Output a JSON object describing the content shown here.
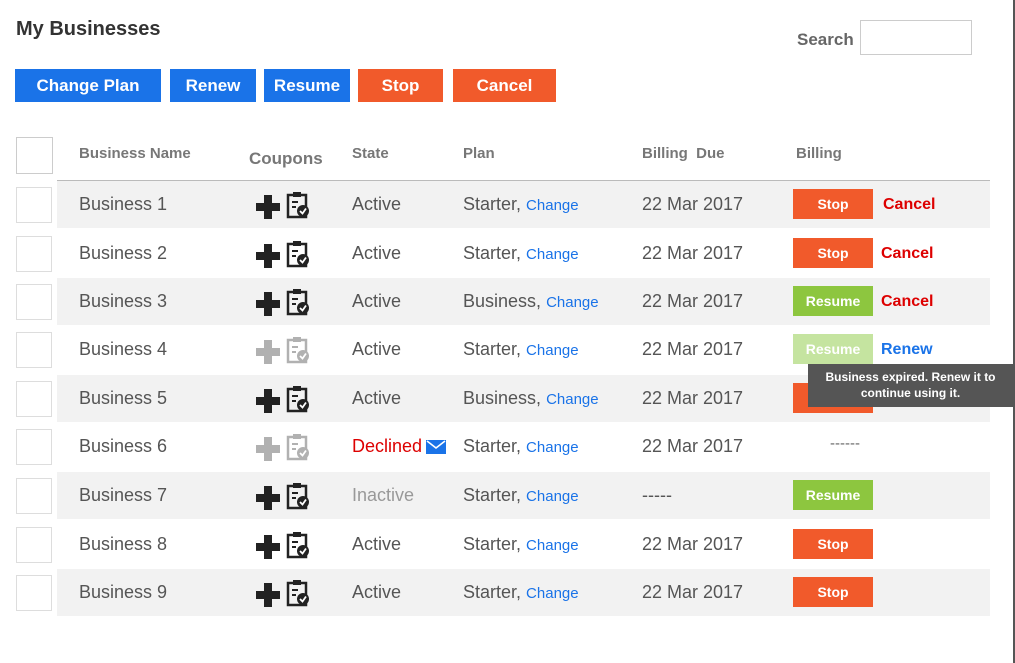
{
  "page": {
    "title": "My Businesses",
    "search_label": "Search",
    "search_value": ""
  },
  "toolbar": {
    "change_plan": "Change Plan",
    "renew": "Renew",
    "resume": "Resume",
    "stop": "Stop",
    "cancel": "Cancel"
  },
  "columns": {
    "business_name": "Business Name",
    "coupons": "Coupons",
    "state": "State",
    "plan": "Plan",
    "billing_due": "Billing  Due",
    "billing": "Billing"
  },
  "rows": [
    {
      "name": "Business 1",
      "state": "Active",
      "plan": "Starter,",
      "plan_link": "Change",
      "due": "22 Mar 2017",
      "btn": "Stop",
      "link": "Cancel"
    },
    {
      "name": "Business 2",
      "state": "Active",
      "plan": "Starter,",
      "plan_link": "Change",
      "due": "22 Mar 2017",
      "btn": "Stop",
      "link": "Cancel"
    },
    {
      "name": "Business 3",
      "state": "Active",
      "plan": "Business,",
      "plan_link": "Change",
      "due": "22 Mar 2017",
      "btn": "Resume",
      "link": "Cancel"
    },
    {
      "name": "Business 4",
      "state": "Active",
      "plan": "Starter,",
      "plan_link": "Change",
      "due": "22 Mar 2017",
      "btn": "Resume",
      "link": "Renew"
    },
    {
      "name": "Business 5",
      "state": "Active",
      "plan": "Business,",
      "plan_link": "Change",
      "due": "22 Mar 2017",
      "btn": "",
      "link": ""
    },
    {
      "name": "Business 6",
      "state": "Declined",
      "plan": "Starter,",
      "plan_link": "Change",
      "due": "22 Mar 2017",
      "btn": "",
      "link": "",
      "billing_text": "------"
    },
    {
      "name": "Business 7",
      "state": "Inactive",
      "plan": "Starter,",
      "plan_link": "Change",
      "due": "-----",
      "btn": "Resume",
      "link": ""
    },
    {
      "name": "Business 8",
      "state": "Active",
      "plan": "Starter,",
      "plan_link": "Change",
      "due": "22 Mar 2017",
      "btn": "Stop",
      "link": ""
    },
    {
      "name": "Business 9",
      "state": "Active",
      "plan": "Starter,",
      "plan_link": "Change",
      "due": "22 Mar 2017",
      "btn": "Stop",
      "link": ""
    }
  ],
  "tooltip": {
    "text": "Business expired. Renew it to continue using it."
  },
  "icons": {
    "coupon_add": "plus-icon",
    "coupon_list": "clipboard-check-icon",
    "declined_notice": "mail-icon"
  },
  "colors": {
    "primary": "#1a73e8",
    "danger": "#f15a2b",
    "success": "#8dc63f",
    "cancel_text": "#dd0000"
  }
}
